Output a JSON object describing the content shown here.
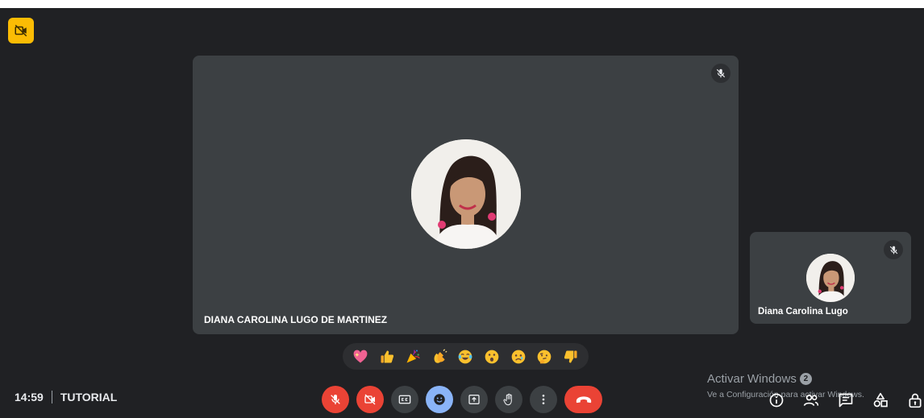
{
  "meeting": {
    "time": "14:59",
    "title": "TUTORIAL"
  },
  "main_tile": {
    "participant_name": "DIANA CAROLINA LUGO DE MARTINEZ",
    "mic_state": "muted"
  },
  "side_tile": {
    "participant_name": "Diana Carolina Lugo",
    "mic_state": "muted"
  },
  "reactions": [
    {
      "name": "sparkling-heart",
      "glyph": "💖"
    },
    {
      "name": "thumbs-up",
      "glyph": "👍"
    },
    {
      "name": "party-popper",
      "glyph": "🎉"
    },
    {
      "name": "clapping-hands",
      "glyph": "👏"
    },
    {
      "name": "tears-of-joy",
      "glyph": "😂"
    },
    {
      "name": "surprised-face",
      "glyph": "😮"
    },
    {
      "name": "crying-face",
      "glyph": "😢"
    },
    {
      "name": "thinking-face",
      "glyph": "🤔"
    },
    {
      "name": "thumbs-down",
      "glyph": "👎"
    }
  ],
  "controls": {
    "microphone": "mic-off-icon",
    "camera": "camera-off-icon",
    "captions": "closed-captions-icon",
    "reactions": "emoji-icon",
    "present": "present-screen-icon",
    "raise_hand": "raise-hand-icon",
    "more": "more-options-icon",
    "leave": "hang-up-icon"
  },
  "activation": {
    "title": "Activar Windows",
    "notification_count": "2",
    "subtitle": "Ve a Configuración para activar Windows."
  },
  "right_tools": {
    "info": "info-icon",
    "people": "people-icon",
    "chat": "chat-icon",
    "activities": "activities-icon",
    "host_controls": "host-controls-icon"
  },
  "colors": {
    "stage_background": "#202124",
    "tile_background": "#3c4043",
    "danger": "#ea4335",
    "accent_blue": "#8ab4f8",
    "recording_badge": "#fbbc04"
  }
}
